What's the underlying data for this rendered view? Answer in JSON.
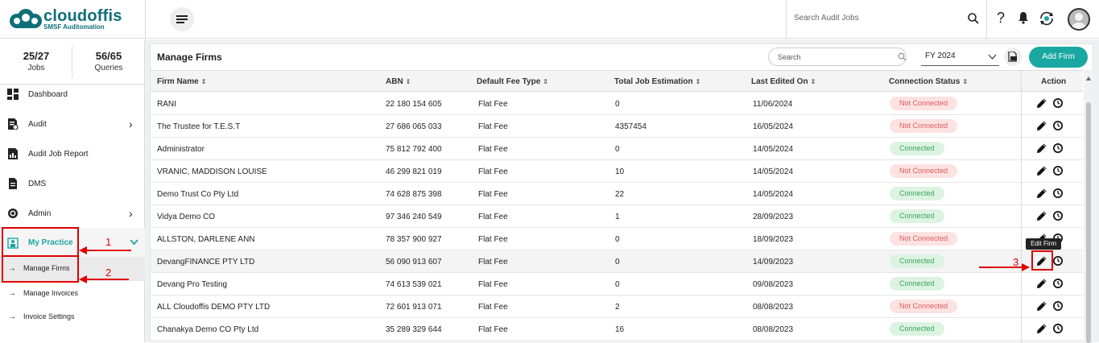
{
  "brand": {
    "name": "cloudoffis",
    "tagline": "SMSF Auditomation",
    "accent": "#1aa7a1",
    "dark": "#0e6f78"
  },
  "topbar": {
    "search_placeholder": "Search Audit Jobs",
    "help_label": "?"
  },
  "sidebar": {
    "stats": [
      {
        "value": "25/27",
        "label": "Jobs"
      },
      {
        "value": "56/65",
        "label": "Queries"
      }
    ],
    "items": [
      {
        "label": "Dashboard",
        "icon": "dashboard-icon"
      },
      {
        "label": "Audit",
        "icon": "audit-icon"
      },
      {
        "label": "Audit Job Report",
        "icon": "report-icon"
      },
      {
        "label": "DMS",
        "icon": "document-icon"
      },
      {
        "label": "Admin",
        "icon": "settings-icon"
      },
      {
        "label": "My Practice",
        "icon": "practice-icon"
      }
    ],
    "subitems": [
      {
        "label": "Manage Firms"
      },
      {
        "label": "Manage Invoices"
      },
      {
        "label": "Invoice Settings"
      }
    ]
  },
  "main": {
    "title": "Manage Firms",
    "search_placeholder": "Search",
    "fy_value": "FY 2024",
    "add_button": "Add Firm",
    "columns": [
      "Firm Name",
      "ABN",
      "Default Fee Type",
      "Total Job Estimation",
      "Last Edited On",
      "Connection Status",
      "Action"
    ],
    "rows": [
      {
        "name": "RANI",
        "abn": "22 180 154 605",
        "fee": "Flat Fee",
        "estimation": "0",
        "edited": "11/06/2024",
        "status": "Not Connected"
      },
      {
        "name": "The Trustee for T.E.S.T",
        "abn": "27 686 065 033",
        "fee": "Flat Fee",
        "estimation": "4357454",
        "edited": "16/05/2024",
        "status": "Not Connected"
      },
      {
        "name": "Administrator",
        "abn": "75 812 792 400",
        "fee": "Flat Fee",
        "estimation": "0",
        "edited": "14/05/2024",
        "status": "Connected"
      },
      {
        "name": "VRANIC, MADDISON LOUISE",
        "abn": "46 299 821 019",
        "fee": "Flat Fee",
        "estimation": "10",
        "edited": "14/05/2024",
        "status": "Not Connected"
      },
      {
        "name": "Demo Trust Co Pty Ltd",
        "abn": "74 628 875 398",
        "fee": "Flat Fee",
        "estimation": "22",
        "edited": "14/05/2024",
        "status": "Connected"
      },
      {
        "name": "Vidya Demo CO",
        "abn": "97 346 240 549",
        "fee": "Flat Fee",
        "estimation": "1",
        "edited": "28/09/2023",
        "status": "Connected"
      },
      {
        "name": "ALLSTON, DARLENE ANN",
        "abn": "78 357 900 927",
        "fee": "Flat Fee",
        "estimation": "0",
        "edited": "18/09/2023",
        "status": "Not Connected"
      },
      {
        "name": "DevangFINANCE PTY LTD",
        "abn": "56 090 913 607",
        "fee": "Flat Fee",
        "estimation": "0",
        "edited": "14/09/2023",
        "status": "Connected"
      },
      {
        "name": "Devang Pro Testing",
        "abn": "74 613 539 021",
        "fee": "Flat Fee",
        "estimation": "0",
        "edited": "09/08/2023",
        "status": "Connected"
      },
      {
        "name": "ALL Cloudoffis DEMO PTY LTD",
        "abn": "72 601 913 071",
        "fee": "Flat Fee",
        "estimation": "2",
        "edited": "08/08/2023",
        "status": "Not Connected"
      },
      {
        "name": "Chanakya Demo CO Pty Ltd",
        "abn": "35 289 329 644",
        "fee": "Flat Fee",
        "estimation": "16",
        "edited": "08/08/2023",
        "status": "Connected"
      }
    ],
    "tooltip": "Edit Firm"
  },
  "annotations": {
    "step_1": "1",
    "step_2": "2",
    "step_3": "3",
    "color": "#e00000"
  }
}
